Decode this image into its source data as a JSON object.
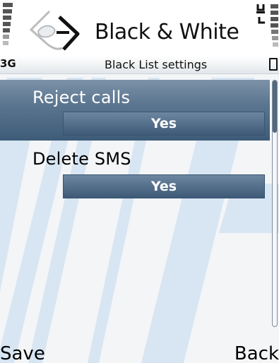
{
  "header": {
    "app_title": "Black & White"
  },
  "subheader": {
    "network": "3G",
    "title": "Black List settings"
  },
  "settings": [
    {
      "label": "Reject calls",
      "value": "Yes",
      "selected": true
    },
    {
      "label": "Delete SMS",
      "value": "Yes",
      "selected": false
    }
  ],
  "softkeys": {
    "left": "Save",
    "right": "Back"
  },
  "icons": {
    "signal": "signal-strength-icon",
    "app": "black-and-white-app-icon",
    "battery": "battery-level-icon",
    "call": "call-status-icon"
  },
  "colors": {
    "selection": "#4d6a87",
    "value_bar": "#4a6682",
    "background_stripes": "#c8dcef"
  }
}
